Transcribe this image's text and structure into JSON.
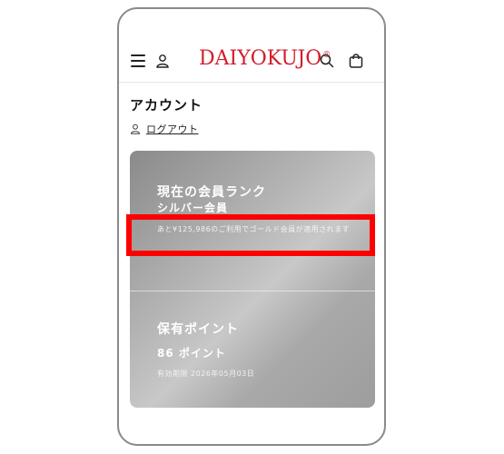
{
  "header": {
    "logo_text": "DAIYOKUJO",
    "logo_mark": "®",
    "brand_color": "#d31c2b",
    "icons": [
      "menu-icon",
      "user-icon",
      "search-icon",
      "cart-icon"
    ]
  },
  "account": {
    "title": "アカウント",
    "logout_label": "ログアウト"
  },
  "membership": {
    "rank_heading": "現在の会員ランク",
    "rank_name": "シルバー会員",
    "rank_note": "あと¥125,986のご利用でゴールド会員が適用されます"
  },
  "points": {
    "heading": "保有ポイント",
    "value": "86 ポイント",
    "expiry": "有効期限 2026年05月03日"
  },
  "colors": {
    "highlight": "#ff0000"
  }
}
